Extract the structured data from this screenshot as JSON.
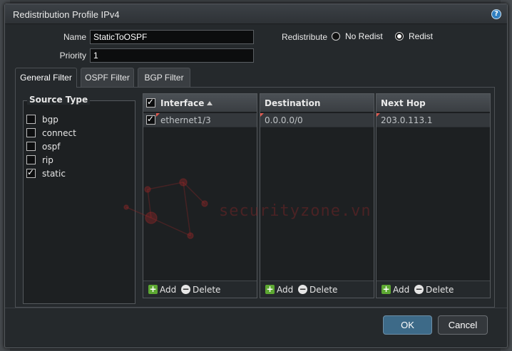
{
  "dialog": {
    "title": "Redistribution Profile IPv4"
  },
  "form": {
    "name_label": "Name",
    "name_value": "StaticToOSPF",
    "priority_label": "Priority",
    "priority_value": "1",
    "redistribute_label": "Redistribute",
    "option_no_redist": "No Redist",
    "option_redist": "Redist",
    "selected": "Redist"
  },
  "tabs": [
    {
      "label": "General Filter",
      "active": true
    },
    {
      "label": "OSPF Filter",
      "active": false
    },
    {
      "label": "BGP Filter",
      "active": false
    }
  ],
  "source_type": {
    "title": "Source Type",
    "items": [
      {
        "label": "bgp",
        "checked": false
      },
      {
        "label": "connect",
        "checked": false
      },
      {
        "label": "ospf",
        "checked": false
      },
      {
        "label": "rip",
        "checked": false
      },
      {
        "label": "static",
        "checked": true
      }
    ]
  },
  "grids": {
    "interface": {
      "header": "Interface",
      "rows": [
        "ethernet1/3"
      ]
    },
    "destination": {
      "header": "Destination",
      "rows": [
        "0.0.0.0/0"
      ]
    },
    "nexthop": {
      "header": "Next Hop",
      "rows": [
        "203.0.113.1"
      ]
    },
    "add_label": "Add",
    "delete_label": "Delete"
  },
  "buttons": {
    "ok": "OK",
    "cancel": "Cancel"
  },
  "watermark": "securityzone.vn",
  "colors": {
    "ok_button": "#3d6a88",
    "add_icon": "#5da832",
    "help_icon": "#2f7fc1"
  }
}
